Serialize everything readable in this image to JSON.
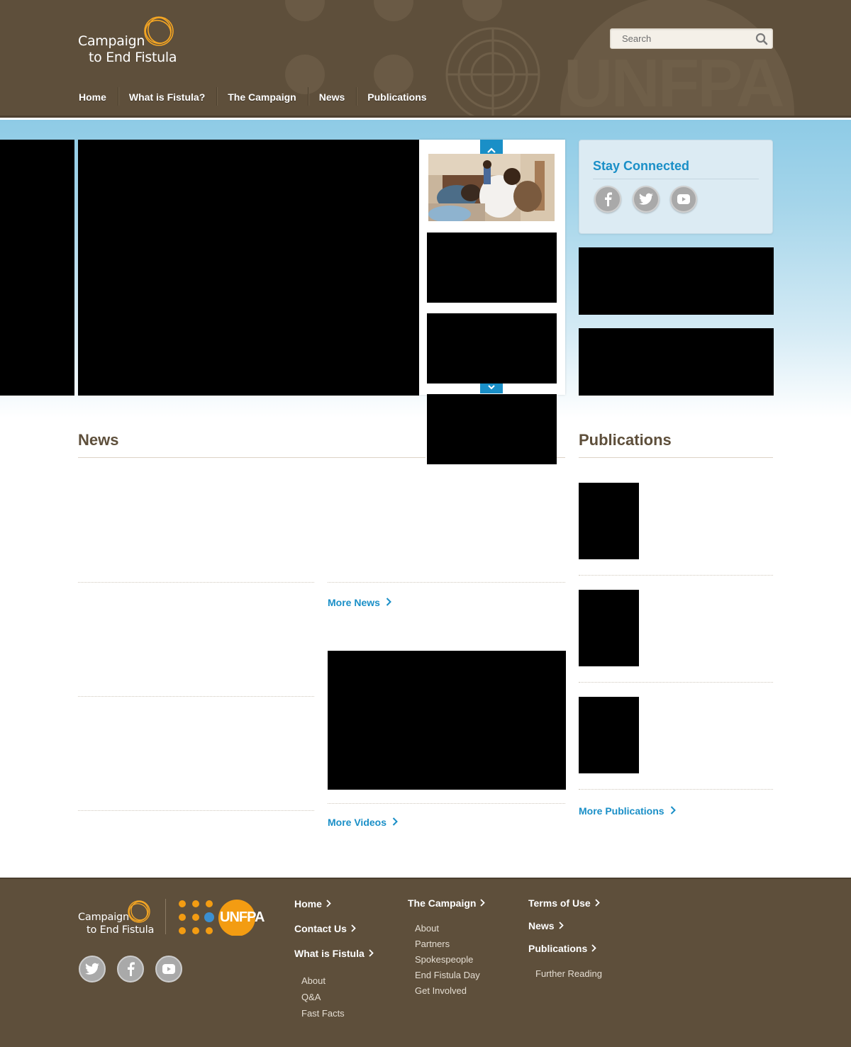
{
  "header": {
    "logo_line1": "Campaign",
    "logo_line2": "to End Fistula",
    "search_placeholder": "Search",
    "nav": [
      "Home",
      "What is Fistula?",
      "The Campaign",
      "News",
      "Publications"
    ]
  },
  "sidebar": {
    "stay_connected_title": "Stay Connected"
  },
  "sections": {
    "news_title": "News",
    "publications_title": "Publications",
    "more_news": "More News",
    "more_videos": "More Videos",
    "more_publications": "More Publications"
  },
  "footer": {
    "logo_line1": "Campaign",
    "logo_line2": "to End Fistula",
    "unfpa_text": "UNFPA",
    "col1": {
      "home": "Home",
      "contact": "Contact Us",
      "fistula": "What is Fistula",
      "sub": [
        "About",
        "Q&A",
        "Fast Facts"
      ]
    },
    "col2": {
      "campaign": "The Campaign",
      "sub": [
        "About",
        "Partners",
        "Spokespeople",
        "End Fistula Day",
        "Get Involved"
      ]
    },
    "col3": {
      "terms": "Terms of Use",
      "news": "News",
      "publications": "Publications",
      "sub": [
        "Further Reading"
      ]
    }
  },
  "colors": {
    "header_brown": "#5e4f3b",
    "accent_blue": "#1a8fc7",
    "logo_orange": "#f39c12",
    "sky_blue": "#8ecbe6"
  },
  "icons": [
    "search-icon",
    "facebook-icon",
    "twitter-icon",
    "youtube-icon",
    "chevron-up-icon",
    "chevron-down-icon",
    "chevron-right-icon"
  ]
}
